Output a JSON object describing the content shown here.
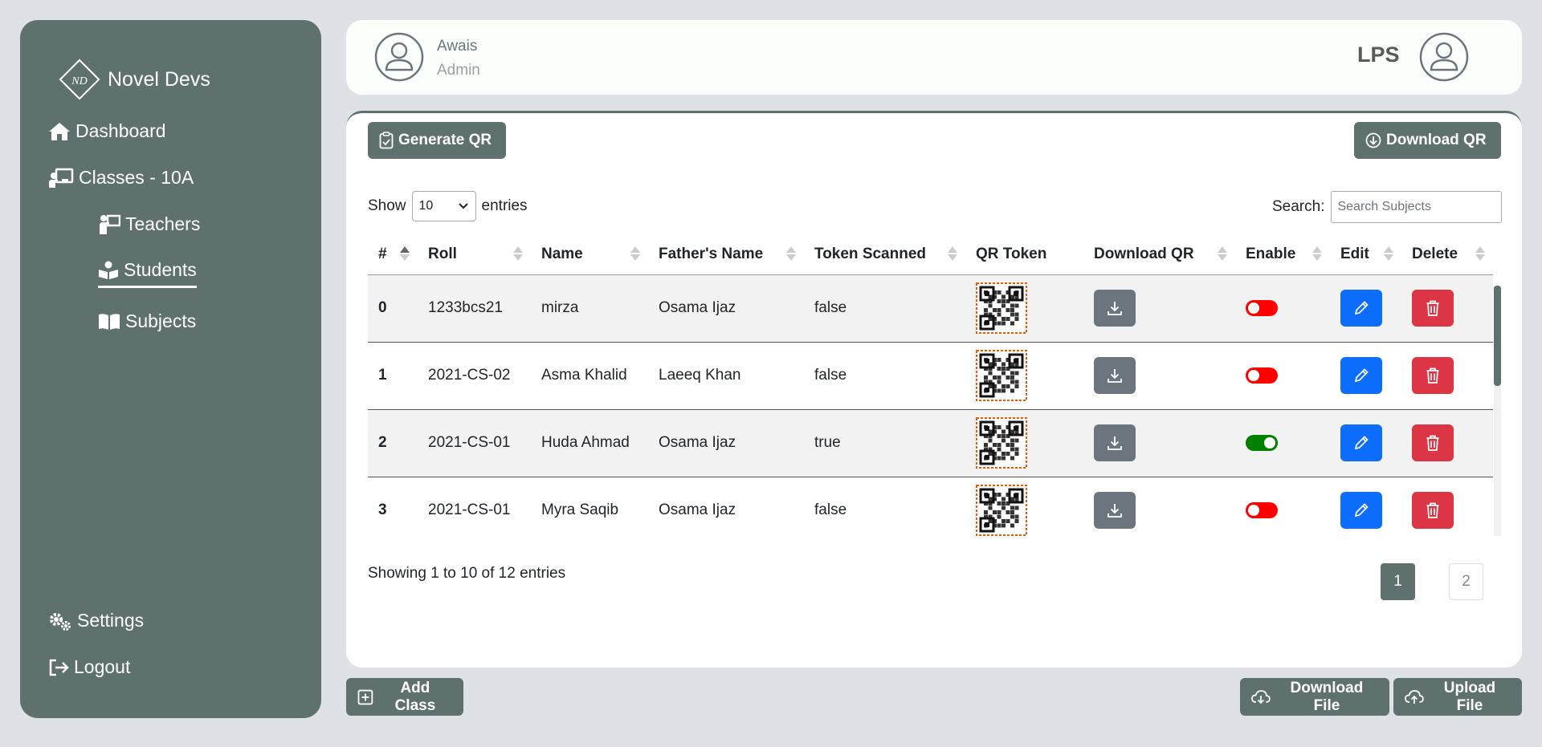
{
  "brand": {
    "name": "Novel Devs",
    "logo_text": "ND"
  },
  "sidebar": {
    "items": [
      {
        "label": "Dashboard",
        "icon": "home-icon"
      },
      {
        "label": "Classes - 10A",
        "icon": "chalkboard-teacher-icon"
      },
      {
        "label": "Teachers",
        "icon": "teacher-icon"
      },
      {
        "label": "Students",
        "icon": "book-reader-icon",
        "active": true
      },
      {
        "label": "Subjects",
        "icon": "book-open-icon"
      }
    ],
    "bottom_items": [
      {
        "label": "Settings",
        "icon": "gears-icon"
      },
      {
        "label": "Logout",
        "icon": "logout-icon"
      }
    ]
  },
  "header": {
    "user_name": "Awais",
    "user_role": "Admin",
    "org_name": "LPS"
  },
  "toolbar": {
    "generate_qr": "Generate QR",
    "download_qr": "Download QR"
  },
  "table_controls": {
    "show_label": "Show",
    "entries_value": "10",
    "entries_label": "entries",
    "search_label": "Search:",
    "search_placeholder": "Search Subjects"
  },
  "table": {
    "columns": [
      "#",
      "Roll",
      "Name",
      "Father's Name",
      "Token Scanned",
      "QR Token",
      "Download QR",
      "Enable",
      "Edit",
      "Delete"
    ],
    "rows": [
      {
        "num": "0",
        "roll": "1233bcs21",
        "name": "mirza",
        "father": "Osama Ijaz",
        "scanned": "false",
        "enabled": false
      },
      {
        "num": "1",
        "roll": "2021-CS-02",
        "name": "Asma Khalid",
        "father": "Laeeq Khan",
        "scanned": "false",
        "enabled": false
      },
      {
        "num": "2",
        "roll": "2021-CS-01",
        "name": "Huda Ahmad",
        "father": "Osama Ijaz",
        "scanned": "true",
        "enabled": true
      },
      {
        "num": "3",
        "roll": "2021-CS-01",
        "name": "Myra Saqib",
        "father": "Osama Ijaz",
        "scanned": "false",
        "enabled": false
      }
    ]
  },
  "pagination": {
    "info": "Showing 1 to 10 of 12 entries",
    "pages": [
      "1",
      "2"
    ],
    "current": "1"
  },
  "footer_buttons": {
    "add_class": "Add Class",
    "download_file": "Download File",
    "upload_file": "Upload File"
  },
  "colors": {
    "primary": "#5f716e",
    "toggle_off": "#ff0000",
    "toggle_on": "#008000",
    "edit": "#0d6efd",
    "delete": "#dc3545",
    "download": "#6c757d"
  }
}
